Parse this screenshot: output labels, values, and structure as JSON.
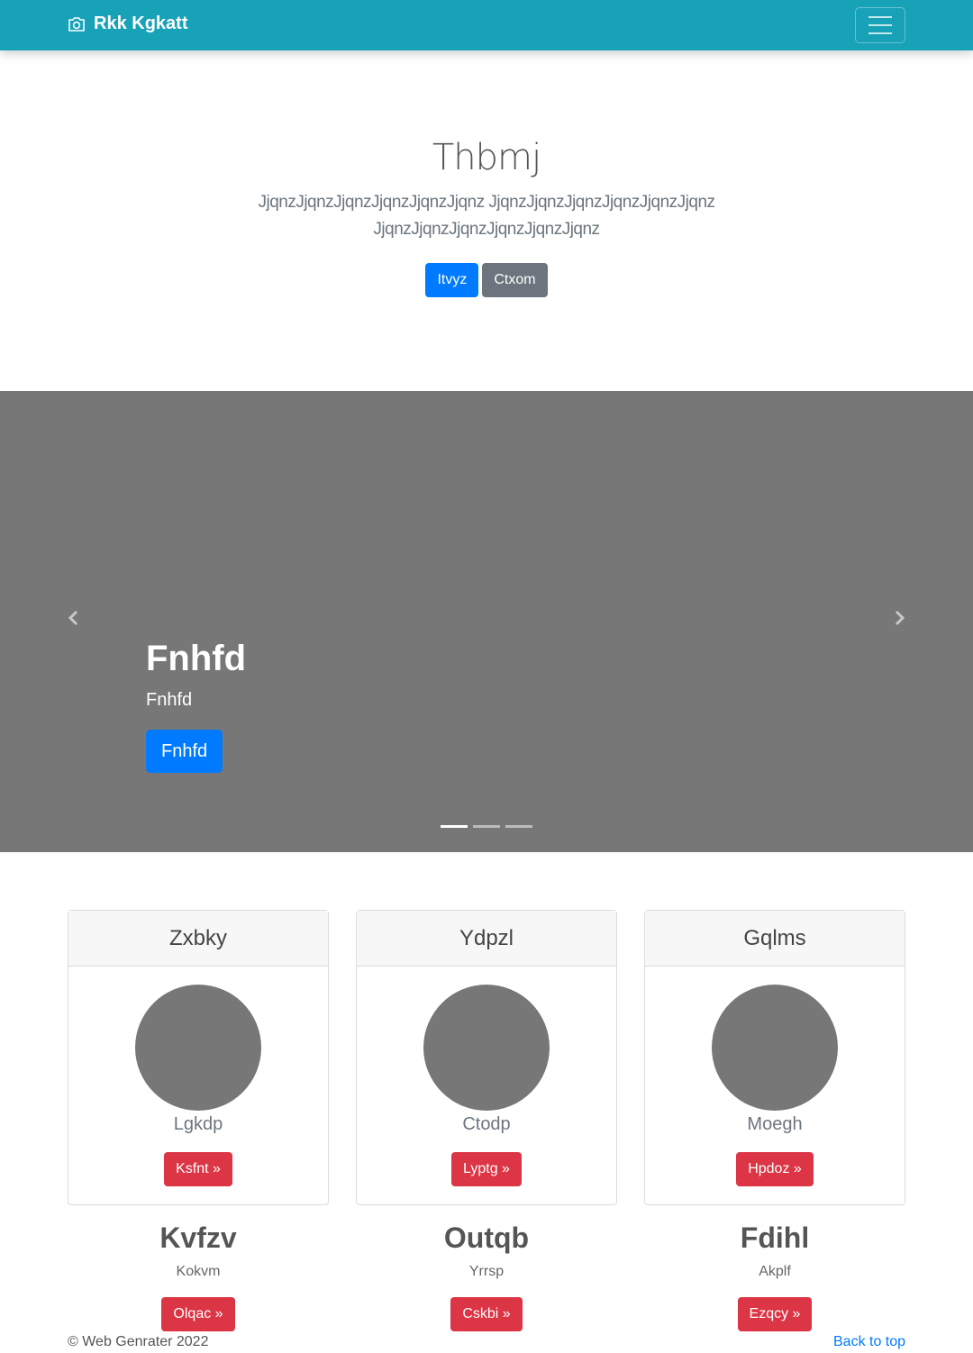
{
  "navbar": {
    "brand": "Rkk Kgkatt"
  },
  "hero": {
    "title": "Thbmj",
    "lead": "JjqnzJjqnzJjqnzJjqnzJjqnzJjqnz JjqnzJjqnzJjqnzJjqnzJjqnzJjqnz JjqnzJjqnzJjqnzJjqnzJjqnzJjqnz",
    "primary_button": "Itvyz",
    "secondary_button": "Ctxom"
  },
  "carousel": {
    "title": "Fnhfd",
    "text": "Fnhfd",
    "button": "Fnhfd",
    "slide_count": 3,
    "active_slide": 1
  },
  "cards": [
    {
      "header": "Zxbky",
      "subtitle": "Lgkdp",
      "button": "Ksfnt »"
    },
    {
      "header": "Ydpzl",
      "subtitle": "Ctodp",
      "button": "Lyptg »"
    },
    {
      "header": "Gqlms",
      "subtitle": "Moegh",
      "button": "Hpdoz »"
    }
  ],
  "features": [
    {
      "title": "Kvfzv",
      "text": "Kokvm",
      "button": "Olqac »"
    },
    {
      "title": "Outqb",
      "text": "Yrrsp",
      "button": "Cskbi »"
    },
    {
      "title": "Fdihl",
      "text": "Akplf",
      "button": "Ezqcy »"
    }
  ],
  "footer": {
    "copyright": "© Web Genrater 2022",
    "back_to_top": "Back to top"
  },
  "colors": {
    "navbar": "#17a2b8",
    "primary": "#007bff",
    "secondary": "#6c757d",
    "danger": "#dc3545",
    "placeholder": "#777777"
  }
}
